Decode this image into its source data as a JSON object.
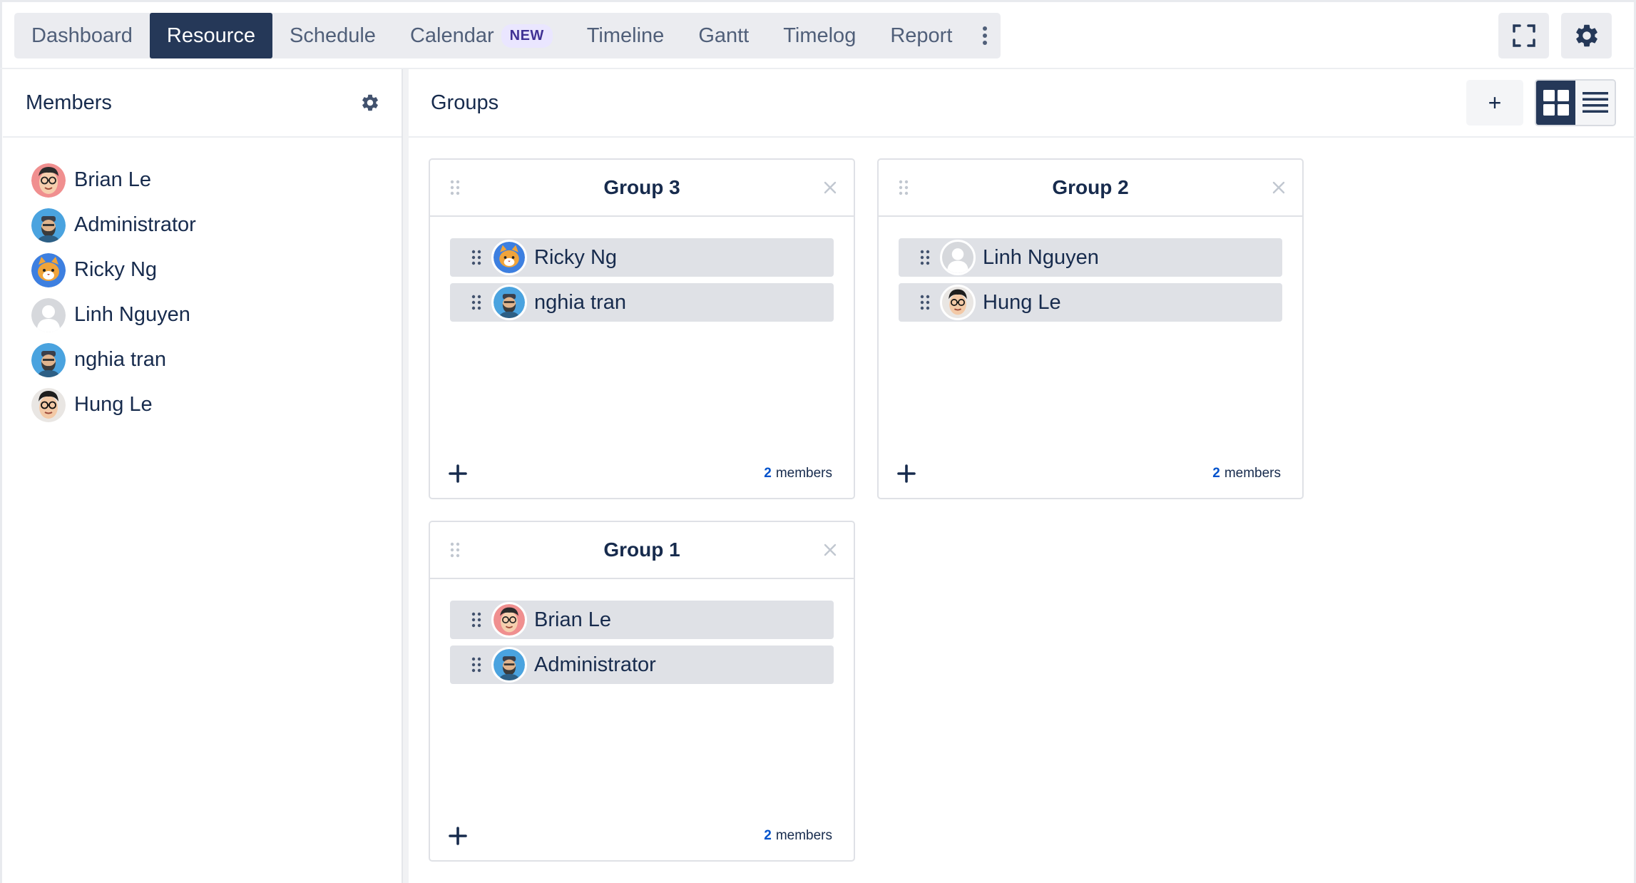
{
  "nav": {
    "tabs": [
      {
        "label": "Dashboard"
      },
      {
        "label": "Resource",
        "active": true
      },
      {
        "label": "Schedule"
      },
      {
        "label": "Calendar",
        "badge": "NEW"
      },
      {
        "label": "Timeline"
      },
      {
        "label": "Gantt"
      },
      {
        "label": "Timelog"
      },
      {
        "label": "Report"
      }
    ],
    "more_icon": "kebab-vertical-icon",
    "fullscreen_icon": "fullscreen-icon",
    "settings_icon": "gear-icon"
  },
  "members_panel": {
    "title": "Members",
    "settings_icon": "gear-icon",
    "members": [
      {
        "name": "Brian Le",
        "avatar": "man-glasses"
      },
      {
        "name": "Administrator",
        "avatar": "bearded-man"
      },
      {
        "name": "Ricky Ng",
        "avatar": "cat"
      },
      {
        "name": "Linh Nguyen",
        "avatar": "default-user"
      },
      {
        "name": "nghia tran",
        "avatar": "bearded-man"
      },
      {
        "name": "Hung Le",
        "avatar": "man-glasses-2"
      }
    ]
  },
  "groups_panel": {
    "title": "Groups",
    "add_label": "+",
    "view_grid_icon": "grid-view-icon",
    "view_list_icon": "list-view-icon",
    "groups": [
      {
        "title": "Group 3",
        "members": [
          {
            "name": "Ricky Ng",
            "avatar": "cat"
          },
          {
            "name": "nghia tran",
            "avatar": "bearded-man"
          }
        ],
        "count": "2",
        "count_label": "members"
      },
      {
        "title": "Group 2",
        "members": [
          {
            "name": "Linh Nguyen",
            "avatar": "default-user"
          },
          {
            "name": "Hung Le",
            "avatar": "man-glasses-2"
          }
        ],
        "count": "2",
        "count_label": "members"
      },
      {
        "title": "Group 1",
        "members": [
          {
            "name": "Brian Le",
            "avatar": "man-glasses"
          },
          {
            "name": "Administrator",
            "avatar": "bearded-man"
          }
        ],
        "count": "2",
        "count_label": "members"
      }
    ]
  },
  "colors": {
    "nav_active": "#253858",
    "accent": "#0052cc",
    "row_bg": "#dfe1e6",
    "badge_bg": "#eae6ff"
  }
}
